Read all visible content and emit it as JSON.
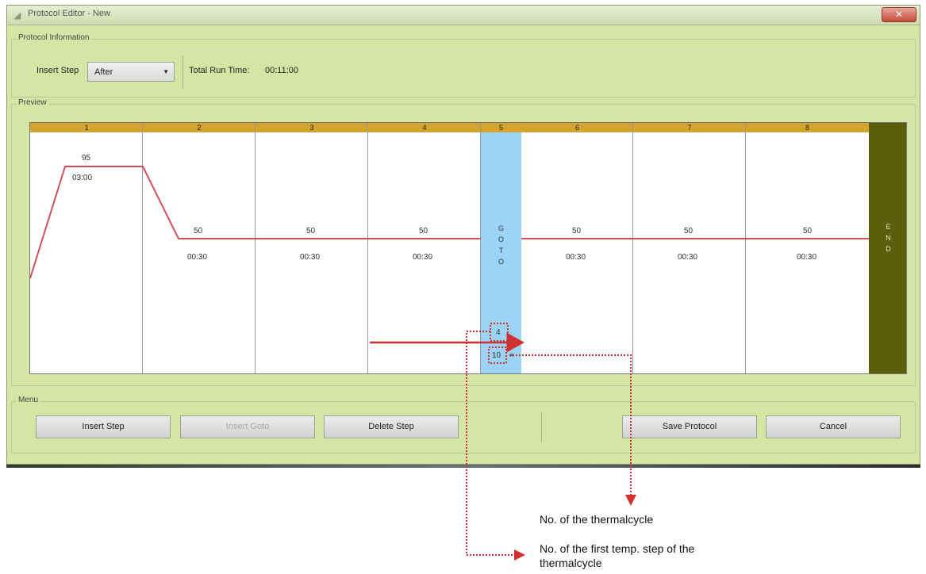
{
  "window": {
    "title": "Protocol Editor - New",
    "close_label": "✕"
  },
  "protocol_info": {
    "group_label": "Protocol Information",
    "insert_step_label": "Insert Step",
    "insert_step_value": "After",
    "total_run_time_label": "Total Run Time:",
    "total_run_time_value": "00:11:00"
  },
  "preview": {
    "group_label": "Preview",
    "steps": [
      {
        "number": "1",
        "temp": "95",
        "time": "03:00"
      },
      {
        "number": "2",
        "temp": "50",
        "time": "00:30"
      },
      {
        "number": "3",
        "temp": "50",
        "time": "00:30"
      },
      {
        "number": "4",
        "temp": "50",
        "time": "00:30"
      },
      {
        "number": "5",
        "goto_letters": [
          "G",
          "O",
          "T",
          "O"
        ],
        "goto_target": "4",
        "goto_cycles": "10"
      },
      {
        "number": "6",
        "temp": "50",
        "time": "00:30"
      },
      {
        "number": "7",
        "temp": "50",
        "time": "00:30"
      },
      {
        "number": "8",
        "temp": "50",
        "time": "00:30"
      }
    ],
    "end_letters": [
      "E",
      "N",
      "D"
    ],
    "cycles_suffix": "x"
  },
  "menu": {
    "group_label": "Menu",
    "insert_step": "Insert Step",
    "insert_goto": "Insert Goto",
    "delete_step": "Delete Step",
    "save_protocol": "Save Protocol",
    "cancel": "Cancel"
  },
  "annotations": {
    "thermalcycle_count": "No. of the thermalcycle",
    "first_step_line1": "No. of the first temp. step of the",
    "first_step_line2": "thermalcycle"
  },
  "colors": {
    "window_bg": "#d5e6a4",
    "step_header": "#d4a52e",
    "goto_column": "#9bd4f7",
    "end_column": "#5b5e0a",
    "profile_line": "#d0505a",
    "annotation": "#d03030"
  }
}
